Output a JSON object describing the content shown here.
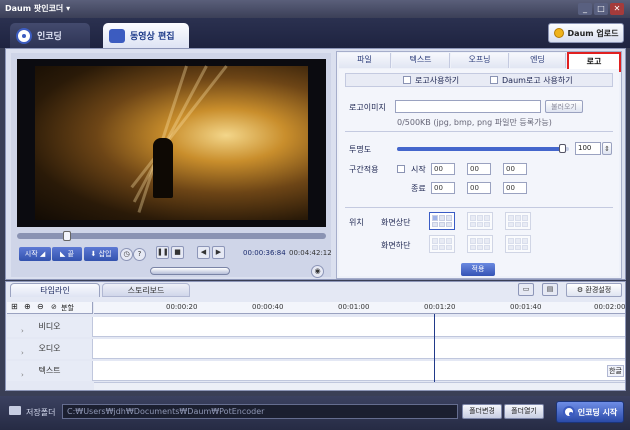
{
  "window": {
    "title": "Daum 팟인코더 ▾",
    "min": "_",
    "max": "□",
    "close": "✕"
  },
  "tabs": [
    {
      "label": "인코딩"
    },
    {
      "label": "동영상 편집"
    }
  ],
  "upgrade": {
    "label": "Daum 업로드"
  },
  "player": {
    "buttons": {
      "start": "시작 ◢",
      "end": "◣ 끝",
      "insert": "⬇ 삽입",
      "clock": "◷",
      "help": "?"
    },
    "time_current": "00:00:36:84",
    "time_total": "00:04:42:12",
    "volume_label": "◉"
  },
  "side_tabs": [
    "파일",
    "텍스트",
    "오프닝",
    "엔딩",
    "로고"
  ],
  "logo": {
    "use_logo": "로고사용하기",
    "use_daum_logo": "Daum로고 사용하기",
    "image_label": "로고이미지",
    "browse": "불러오기",
    "size_hint": "0/500KB (jpg, bmp, png 파일만 등록가능)",
    "opacity_label": "투명도",
    "opacity_value": "100",
    "opacity_fraction": 0.96,
    "range_label": "구간적용",
    "start_label": "시작",
    "end_label": "종료",
    "time_fields": [
      "00",
      "00",
      "00",
      "00"
    ],
    "position_label": "위치",
    "top_label": "화면상단",
    "bottom_label": "화면하단",
    "apply": "적용"
  },
  "timeline": {
    "tabs": [
      "타임라인",
      "스토리보드"
    ],
    "split": "분할",
    "env": "환경설정",
    "ruler": [
      "00:00:20",
      "00:00:40",
      "00:01:00",
      "00:01:20",
      "00:01:40",
      "00:02:00"
    ],
    "tracks": [
      "비디오",
      "오디오",
      "텍스트"
    ],
    "more": "한글"
  },
  "bottom": {
    "save_folder": "저장폴더",
    "path": "C:₩Users₩jdh₩Documents₩Daum₩PotEncoder",
    "change": "폴더변경",
    "open": "폴더열기",
    "start": "인코딩 시작"
  }
}
